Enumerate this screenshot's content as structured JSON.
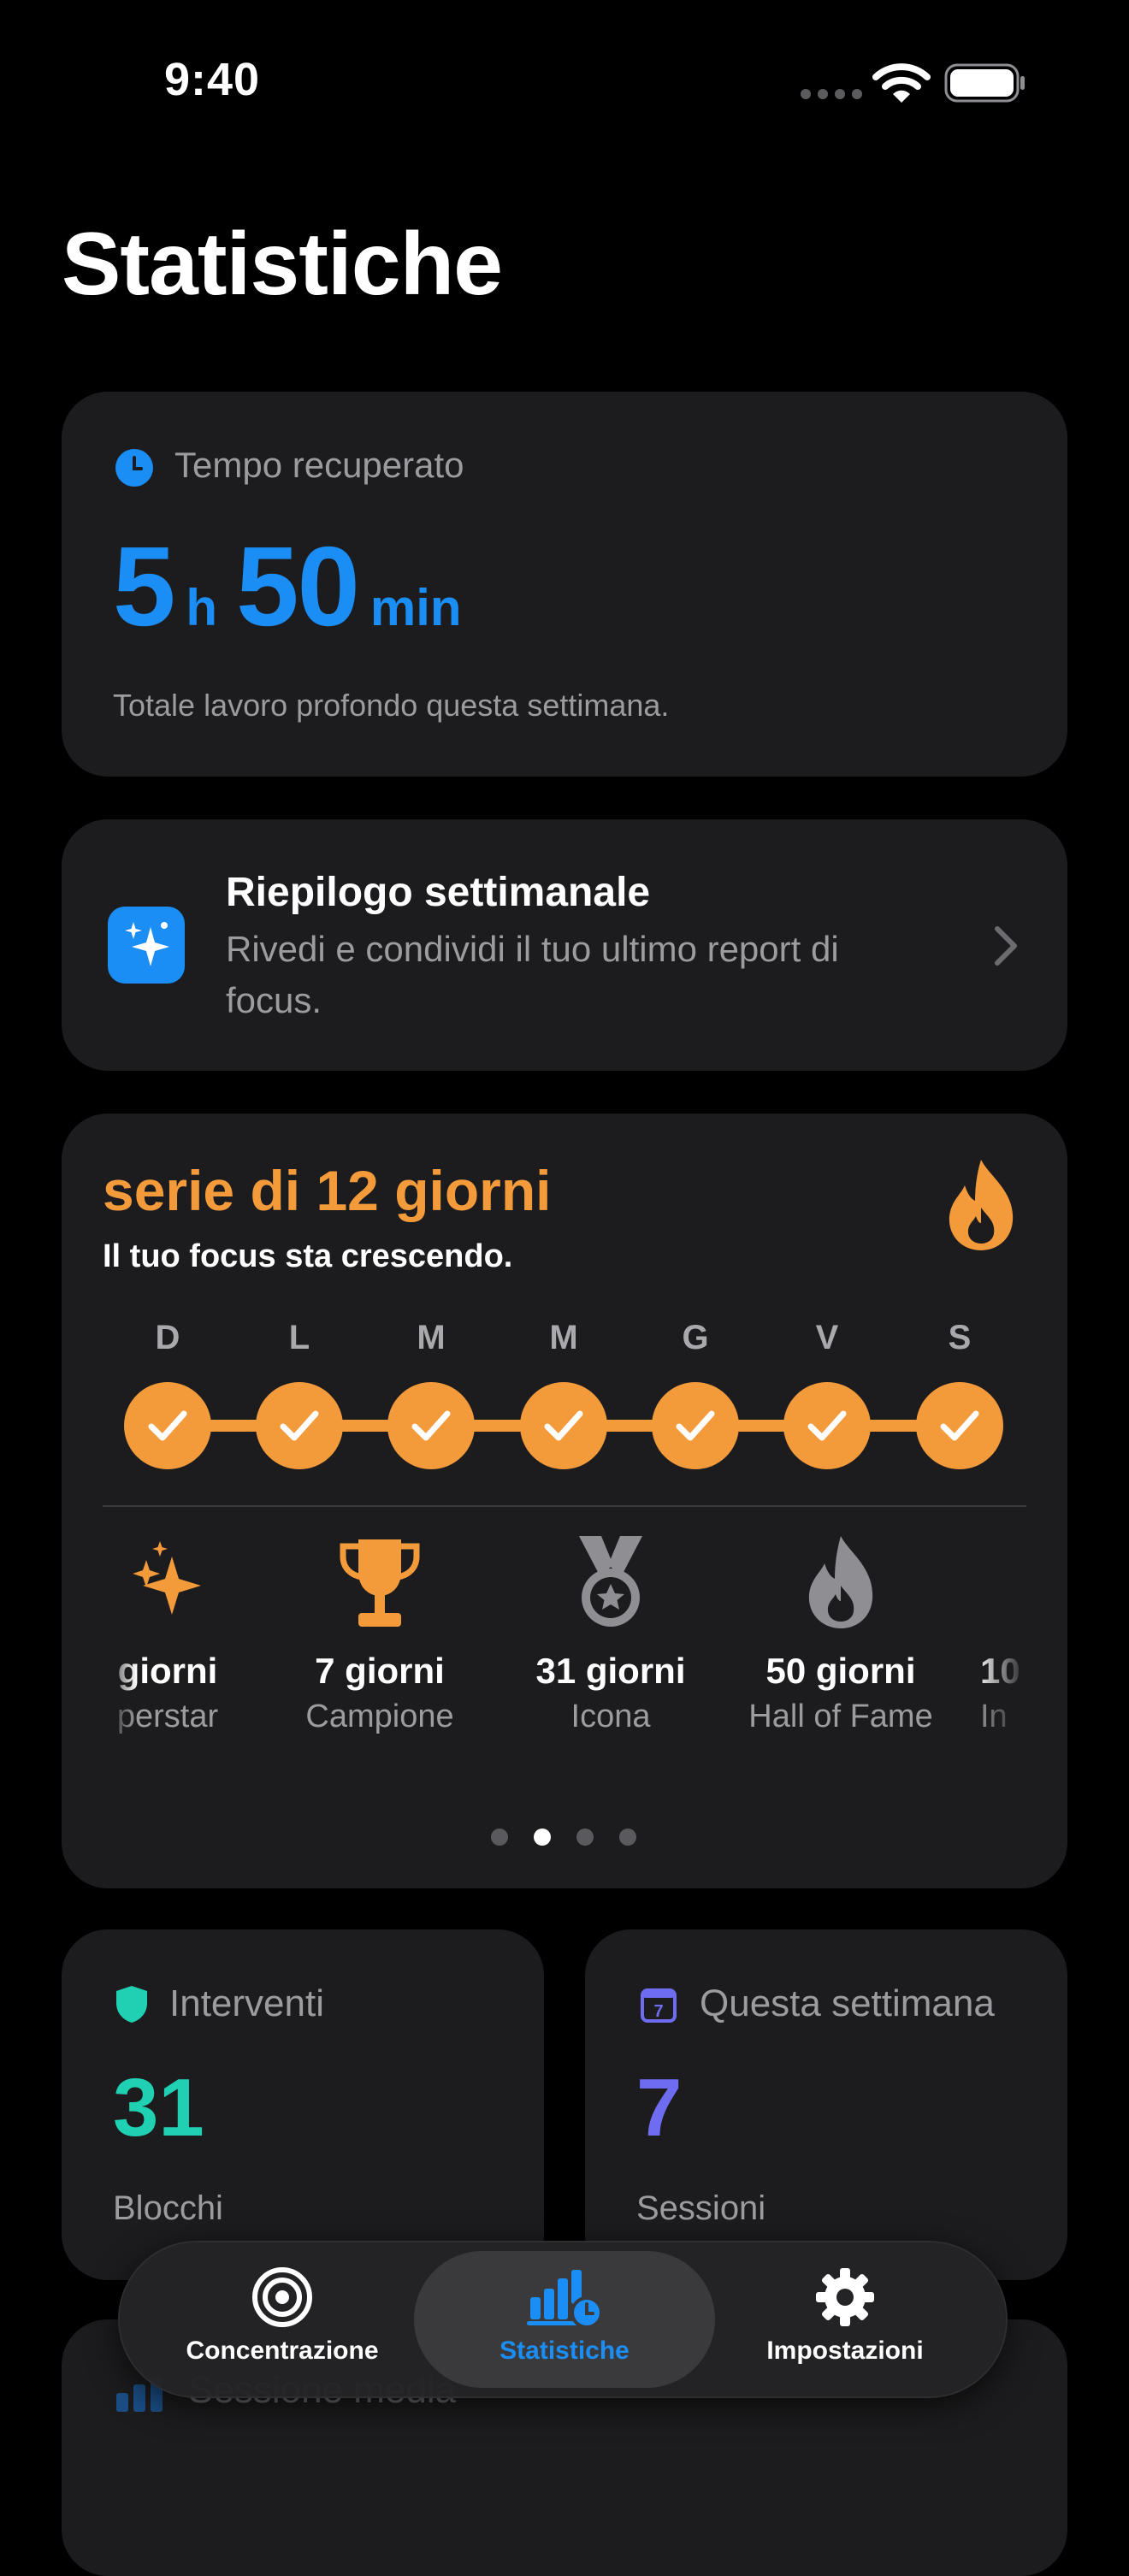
{
  "status": {
    "time": "9:40"
  },
  "page": {
    "title": "Statistiche"
  },
  "time_saved": {
    "icon": "clock-icon",
    "label": "Tempo recuperato",
    "hours": "5",
    "hours_unit": "h",
    "minutes": "50",
    "minutes_unit": "min",
    "description": "Totale lavoro profondo questa settimana.",
    "color": "#1B8EF5"
  },
  "weekly_summary": {
    "icon": "sparkles-icon",
    "title": "Riepilogo settimanale",
    "description": "Rivedi e condividi il tuo ultimo report di focus."
  },
  "streak": {
    "title": "serie di 12 giorni",
    "subtitle": "Il tuo focus sta crescendo.",
    "color": "#F39A3B",
    "days": [
      "D",
      "L",
      "M",
      "M",
      "G",
      "V",
      "S"
    ],
    "completed": [
      true,
      true,
      true,
      true,
      true,
      true,
      true
    ],
    "badges": [
      {
        "title": "giorni",
        "subtitle": "perstar",
        "icon": "sparkles-icon"
      },
      {
        "title": "7 giorni",
        "subtitle": "Campione",
        "icon": "trophy-icon"
      },
      {
        "title": "31 giorni",
        "subtitle": "Icona",
        "icon": "medal-icon"
      },
      {
        "title": "50 giorni",
        "subtitle": "Hall of Fame",
        "icon": "flame-icon"
      },
      {
        "title": "10",
        "subtitle": "In",
        "icon": ""
      }
    ],
    "page_count": 4,
    "active_page": 1
  },
  "interventions": {
    "label": "Interventi",
    "value": "31",
    "unit": "Blocchi",
    "color": "#1FD1B2",
    "icon": "shield-icon"
  },
  "this_week": {
    "label": "Questa settimana",
    "value": "7",
    "unit": "Sessioni",
    "color": "#6E6CF0",
    "icon": "calendar-icon"
  },
  "avg_session": {
    "label": "Sessione media",
    "icon": "chart-icon"
  },
  "tabbar": {
    "items": [
      {
        "label": "Concentrazione",
        "icon": "target-icon"
      },
      {
        "label": "Statistiche",
        "icon": "stats-chart-icon"
      },
      {
        "label": "Impostazioni",
        "icon": "gear-icon"
      }
    ],
    "active": 1,
    "accent": "#1B8EF5"
  }
}
